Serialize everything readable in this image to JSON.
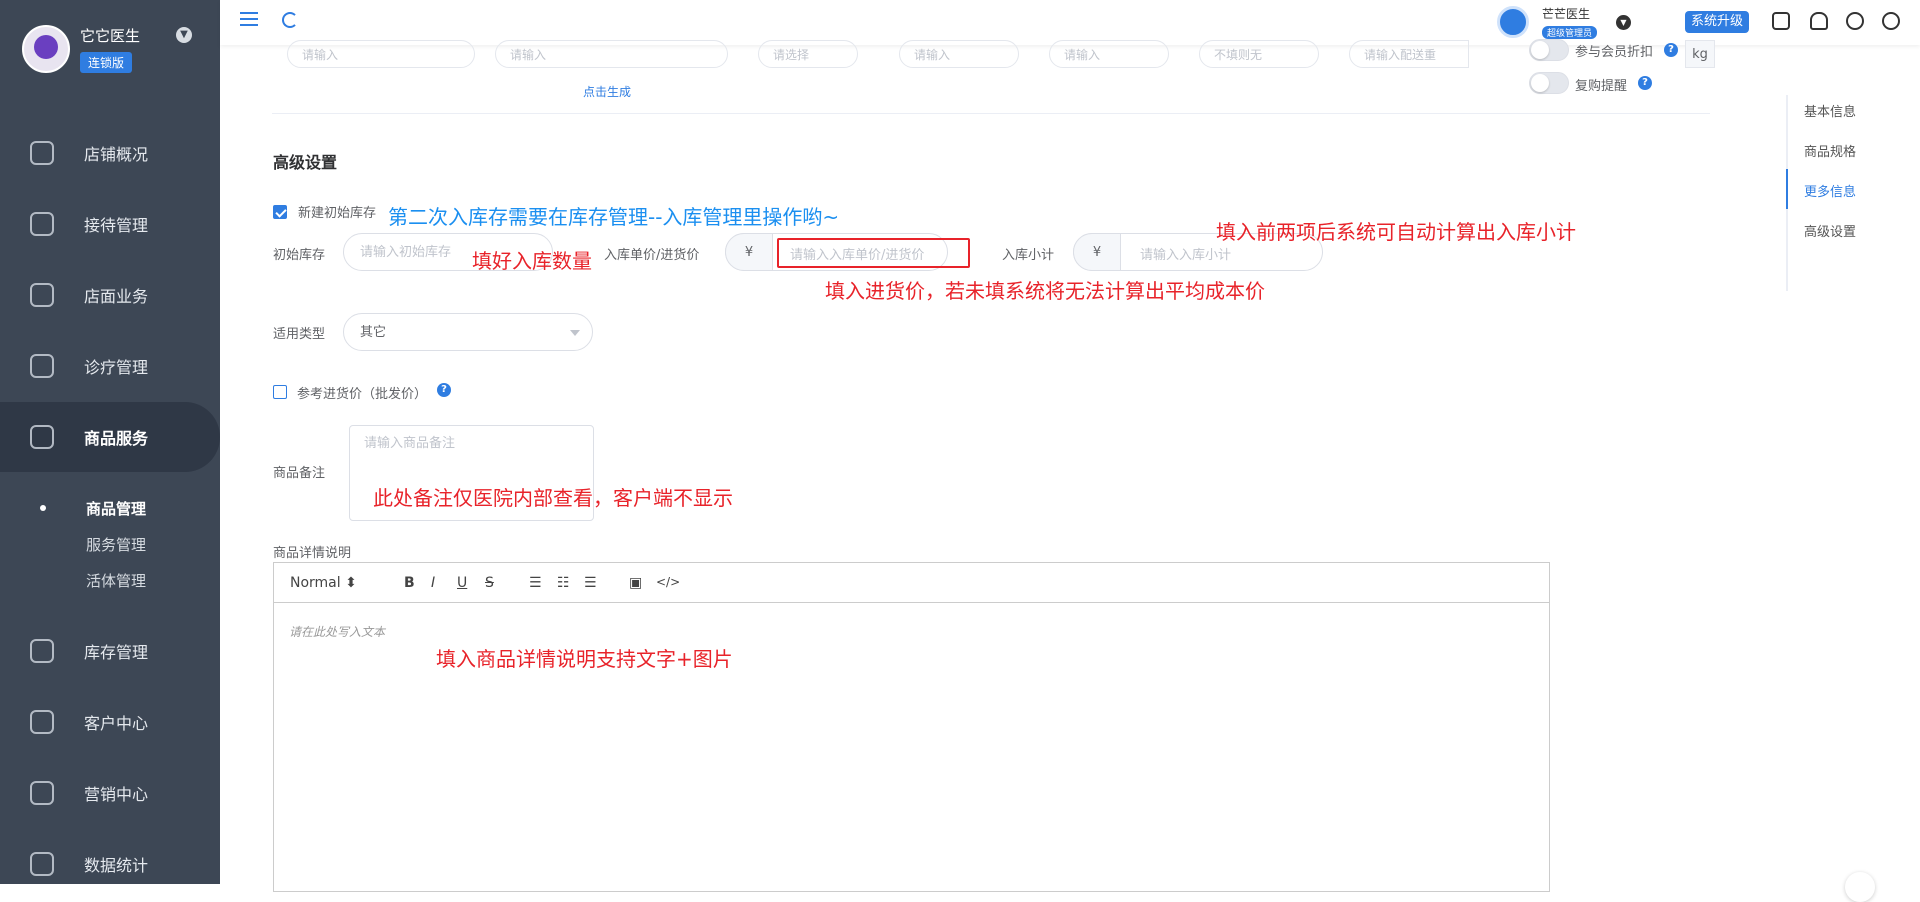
{
  "sidebar": {
    "store_name": "它它医生",
    "store_badge": "连锁版",
    "nav": [
      {
        "label": "店铺概况",
        "icon": "monitor-icon"
      },
      {
        "label": "接待管理",
        "icon": "clipboard-icon"
      },
      {
        "label": "店面业务",
        "icon": "house-icon"
      },
      {
        "label": "诊疗管理",
        "icon": "medkit-icon"
      },
      {
        "label": "商品服务",
        "icon": "bag-icon"
      },
      {
        "label": "库存管理",
        "icon": "box-icon"
      },
      {
        "label": "客户中心",
        "icon": "user-head-icon"
      },
      {
        "label": "营销中心",
        "icon": "chart-bars-icon"
      },
      {
        "label": "数据统计",
        "icon": "trend-icon"
      }
    ],
    "sub_items": [
      "商品管理",
      "服务管理",
      "活体管理"
    ]
  },
  "topbar": {
    "user_name": "芒芒医生",
    "user_role": "超级管理员",
    "upgrade_label": "系统升级"
  },
  "top_row": {
    "placeholder_1": "请输入",
    "placeholder_2": "请输入",
    "generate_link": "点击生成",
    "select_placeholder": "请选择",
    "placeholder_3": "请输入",
    "placeholder_4": "请输入",
    "placeholder_5": "不填则无",
    "weight_placeholder": "请输入配送重",
    "weight_unit": "kg",
    "toggle_1_label": "参与会员折扣",
    "toggle_2_label": "复购提醒"
  },
  "advanced": {
    "title": "高级设置",
    "new_stock_label": "新建初始库存",
    "initial_stock_label": "初始库存",
    "initial_stock_placeholder": "请输入初始库存",
    "unit_price_label": "入库单价/进货价",
    "currency": "¥",
    "unit_price_placeholder": "请输入入库单价/进货价",
    "subtotal_label": "入库小计",
    "subtotal_placeholder": "请输入入库小计",
    "type_label": "适用类型",
    "type_value": "其它",
    "ref_price_label": "参考进货价（批发价）",
    "remark_label": "商品备注",
    "remark_placeholder": "请输入商品备注",
    "detail_label": "商品详情说明"
  },
  "editor": {
    "format_value": "Normal",
    "placeholder": "请在此处写入文本"
  },
  "annotations": {
    "blue_note": "第二次入库存需要在库存管理--入库管理里操作哟~",
    "fill_qty": "填好入库数量",
    "auto_calc": "填入前两项后系统可自动计算出入库小计",
    "purchase_price": "填入进货价，若未填系统将无法计算出平均成本价",
    "remark_note": "此处备注仅医院内部查看，客户端不显示",
    "detail_note": "填入商品详情说明支持文字+图片"
  },
  "right_nav": [
    "基本信息",
    "商品规格",
    "更多信息",
    "高级设置"
  ],
  "colors": {
    "accent": "#2f7de1",
    "sidebar": "#3d4755",
    "annotation_red": "#e8232a",
    "annotation_blue": "#1b8ff0"
  }
}
